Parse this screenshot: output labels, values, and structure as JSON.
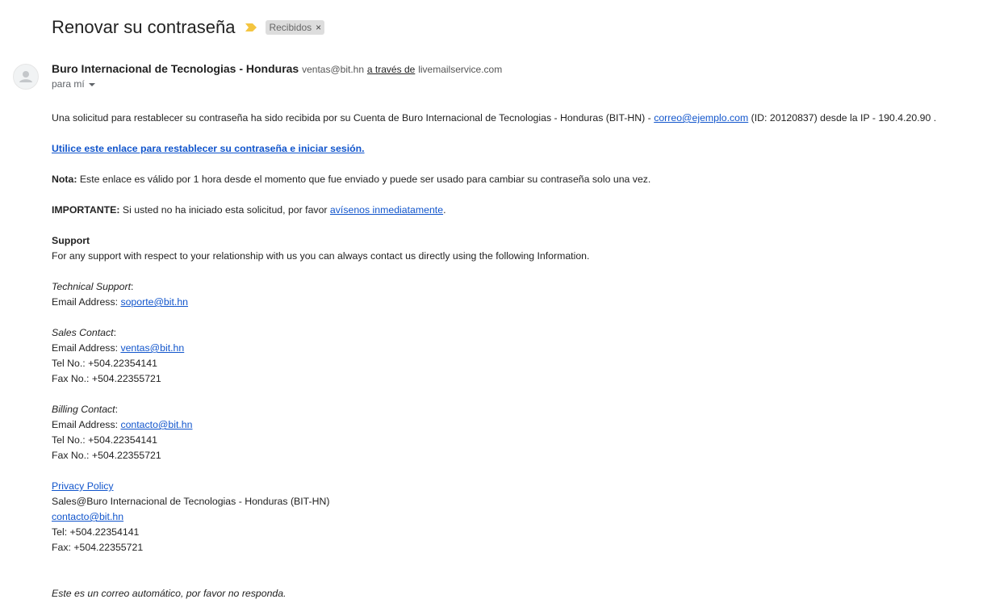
{
  "header": {
    "subject": "Renovar su contraseña",
    "importance_icon": "importance-marker-icon",
    "importance_color": "#f4c540",
    "label_chip": "Recibidos",
    "label_remove_icon": "close-icon"
  },
  "sender": {
    "name": "Buro Internacional de Tecnologias - Honduras",
    "email": "ventas@bit.hn",
    "via_text": "a través de",
    "via_domain": "livemailservice.com",
    "to_text": "para mí",
    "avatar_icon": "person-icon"
  },
  "body": {
    "intro_text": "Una solicitud para restablecer su contraseña ha sido recibida por su Cuenta de Buro Internacional de Tecnologias - Honduras (BIT-HN) - ",
    "intro_email": "correo@ejemplo.com",
    "intro_tail": " (ID: 20120837) desde la IP - 190.4.20.90 .",
    "reset_link": "Utilice este enlace para restablecer su contraseña e iniciar sesión.",
    "note_label": "Nota:",
    "note_text": " Este enlace es válido por 1 hora desde el momento que fue enviado y puede ser usado para cambiar su contraseña solo una vez.",
    "important_label": "IMPORTANTE:",
    "important_text": " Si usted no ha iniciado esta solicitud, por favor ",
    "important_link": "avísenos inmediatamente",
    "important_tail": ".",
    "support_title": "Support",
    "support_text": "For any support with respect to your relationship with us you can always contact us directly using the following Information.",
    "technical_label": "Technical Support",
    "technical_colon": ":",
    "email_address_label": "Email Address: ",
    "technical_email": "soporte@bit.hn",
    "sales_label": "Sales Contact",
    "sales_colon": ":",
    "sales_email": "ventas@bit.hn",
    "sales_tel": "Tel No.: +504.22354141",
    "sales_fax": "Fax No.: +504.22355721",
    "billing_label": "Billing Contact",
    "billing_colon": ":",
    "billing_email": "contacto@bit.hn",
    "billing_tel": "Tel No.: +504.22354141",
    "billing_fax": "Fax No.: +504.22355721",
    "privacy_link": "Privacy Policy",
    "footer_org": "Sales@Buro Internacional de Tecnologias - Honduras (BIT-HN)",
    "footer_email": "contacto@bit.hn",
    "footer_tel": "Tel: +504.22354141",
    "footer_fax": "Fax: +504.22355721",
    "auto_notice": "Este es un correo automático, por favor no responda."
  },
  "colors": {
    "link": "#1155cc",
    "text": "#222222",
    "secondary": "#5f6368",
    "chip_bg": "#dddddd"
  }
}
